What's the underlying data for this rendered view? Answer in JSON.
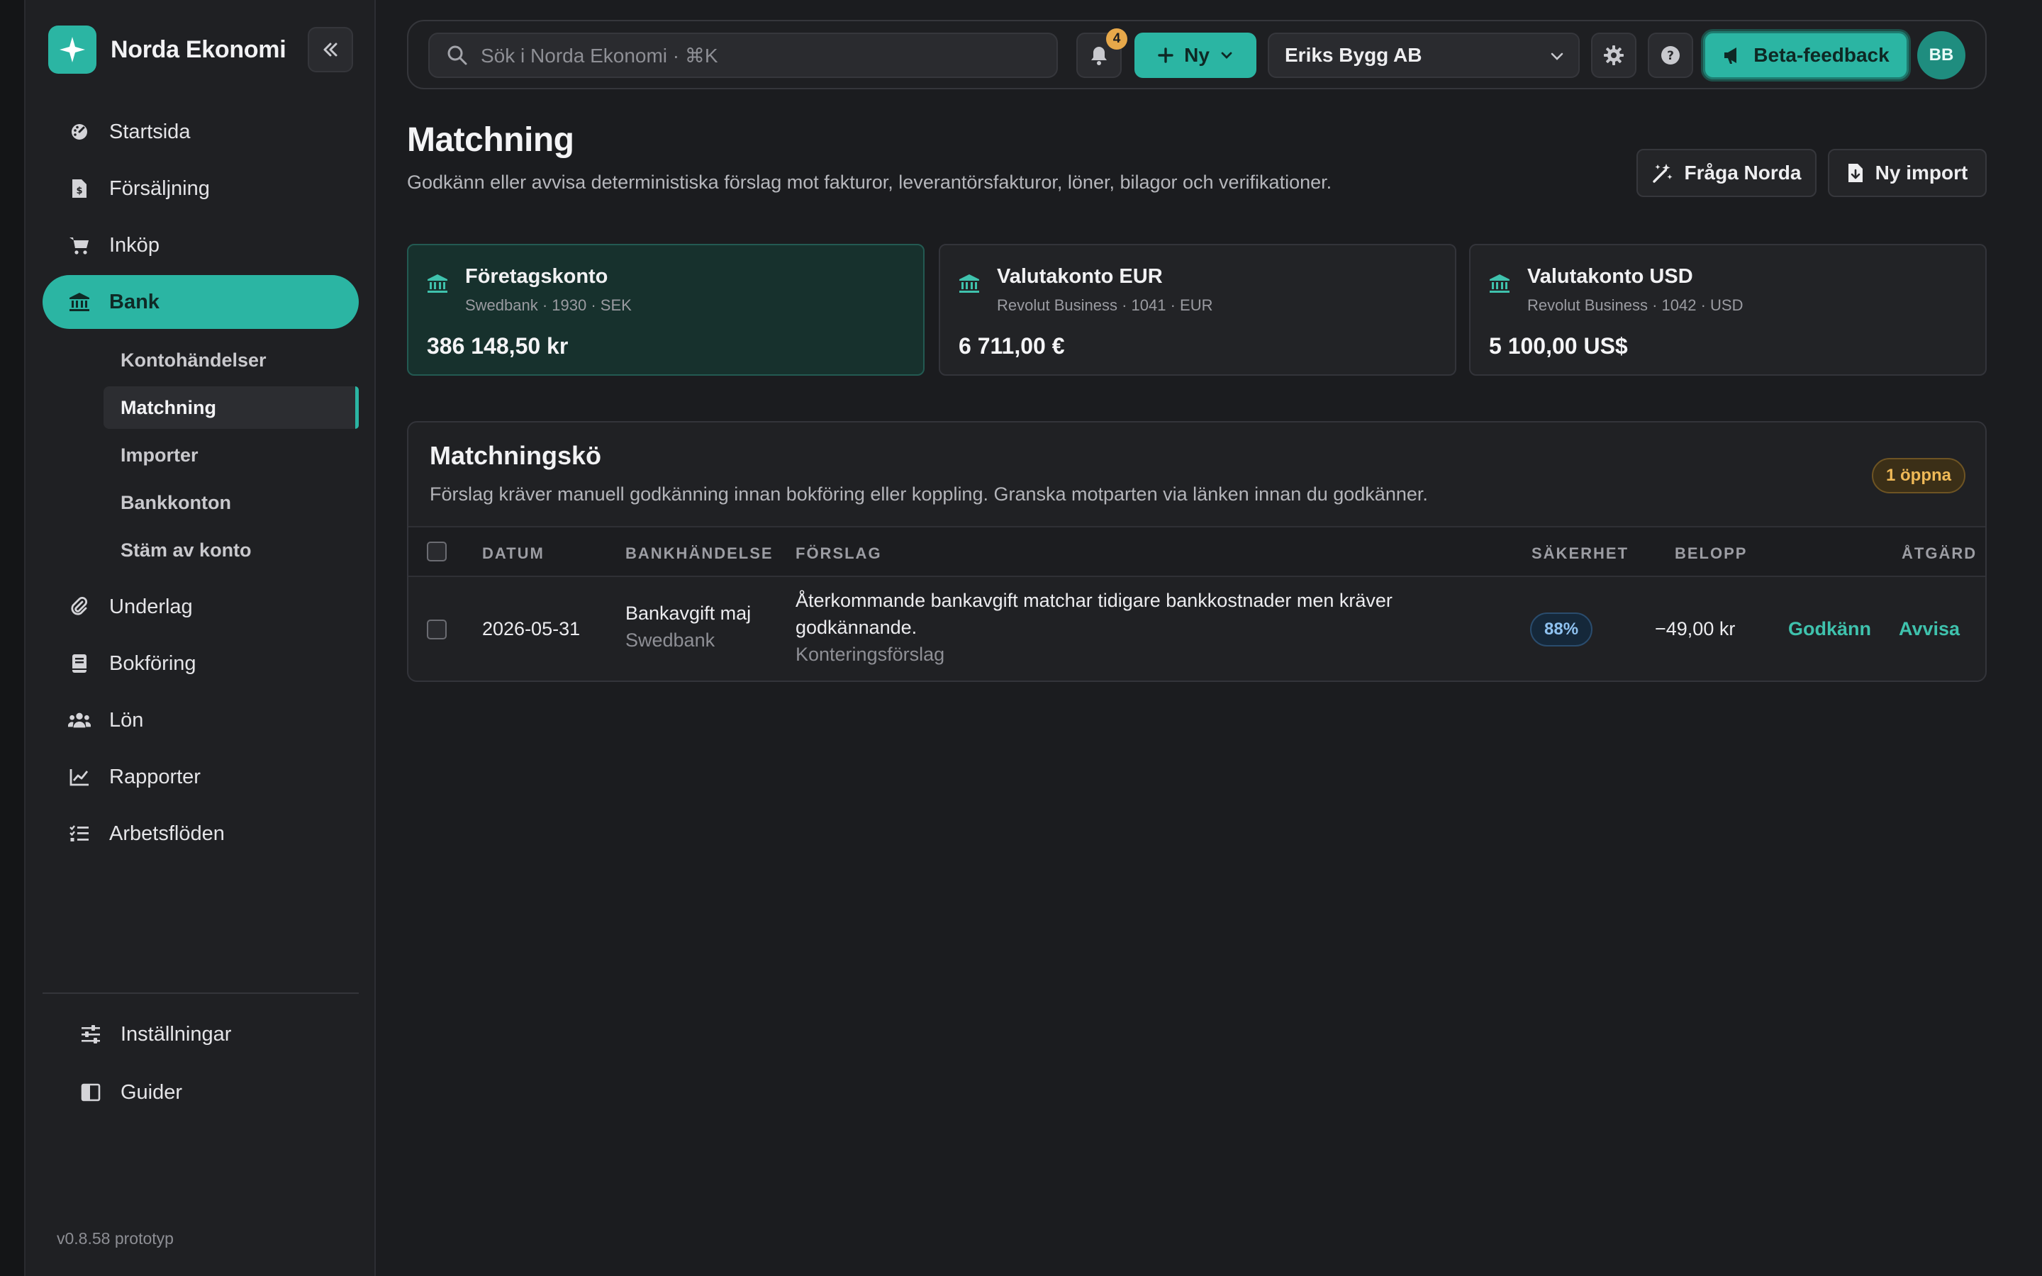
{
  "app": {
    "name": "Norda Ekonomi",
    "version": "v0.8.58 prototyp"
  },
  "sidebar": {
    "items": [
      {
        "label": "Startsida",
        "icon": "dashboard-icon"
      },
      {
        "label": "Försäljning",
        "icon": "invoice-icon"
      },
      {
        "label": "Inköp",
        "icon": "cart-icon"
      },
      {
        "label": "Bank",
        "icon": "bank-icon",
        "active": true
      },
      {
        "label": "Underlag",
        "icon": "paperclip-icon"
      },
      {
        "label": "Bokföring",
        "icon": "book-icon"
      },
      {
        "label": "Lön",
        "icon": "people-icon"
      },
      {
        "label": "Rapporter",
        "icon": "chart-icon"
      },
      {
        "label": "Arbetsflöden",
        "icon": "checklist-icon"
      }
    ],
    "bank_sub": [
      {
        "label": "Kontohändelser"
      },
      {
        "label": "Matchning",
        "active": true
      },
      {
        "label": "Importer"
      },
      {
        "label": "Bankkonton"
      },
      {
        "label": "Stäm av konto"
      }
    ],
    "bottom": [
      {
        "label": "Inställningar",
        "icon": "sliders-icon"
      },
      {
        "label": "Guider",
        "icon": "guide-book-icon"
      }
    ]
  },
  "topbar": {
    "search_placeholder": "Sök i Norda Ekonomi · ⌘K",
    "notification_count": "4",
    "new_label": "Ny",
    "company": "Eriks Bygg AB",
    "beta_label": "Beta-feedback",
    "avatar_initials": "BB"
  },
  "page": {
    "title": "Matchning",
    "subtitle": "Godkänn eller avvisa deterministiska förslag mot fakturor, leverantörsfakturor, löner, bilagor och verifikationer.",
    "ask_label": "Fråga Norda",
    "import_label": "Ny import"
  },
  "accounts": [
    {
      "name": "Företagskonto",
      "meta": "Swedbank · 1930 · SEK",
      "balance": "386 148,50 kr",
      "active": true
    },
    {
      "name": "Valutakonto EUR",
      "meta": "Revolut Business · 1041 · EUR",
      "balance": "6 711,00 €"
    },
    {
      "name": "Valutakonto USD",
      "meta": "Revolut Business · 1042 · USD",
      "balance": "5 100,00 US$"
    }
  ],
  "queue": {
    "title": "Matchningskö",
    "subtitle": "Förslag kräver manuell godkänning innan bokföring eller koppling. Granska motparten via länken innan du godkänner.",
    "open_badge": "1 öppna",
    "columns": {
      "date": "DATUM",
      "txn": "BANKHÄNDELSE",
      "suggestion": "FÖRSLAG",
      "confidence": "SÄKERHET",
      "amount": "BELOPP",
      "action": "ÅTGÄRD"
    },
    "rows": [
      {
        "date": "2026-05-31",
        "txn": "Bankavgift maj",
        "bank": "Swedbank",
        "suggestion_line1": "Återkommande bankavgift matchar tidigare bankkostnader men kräver",
        "suggestion_line2": "godkännande.",
        "suggestion_type": "Konteringsförslag",
        "confidence": "88%",
        "amount": "−49,00 kr",
        "approve": "Godkänn",
        "reject": "Avvisa"
      }
    ]
  },
  "colors": {
    "accent": "#2bb5a3",
    "background": "#1b1c1f",
    "warning": "#efb957",
    "info": "#8fc2f0"
  }
}
